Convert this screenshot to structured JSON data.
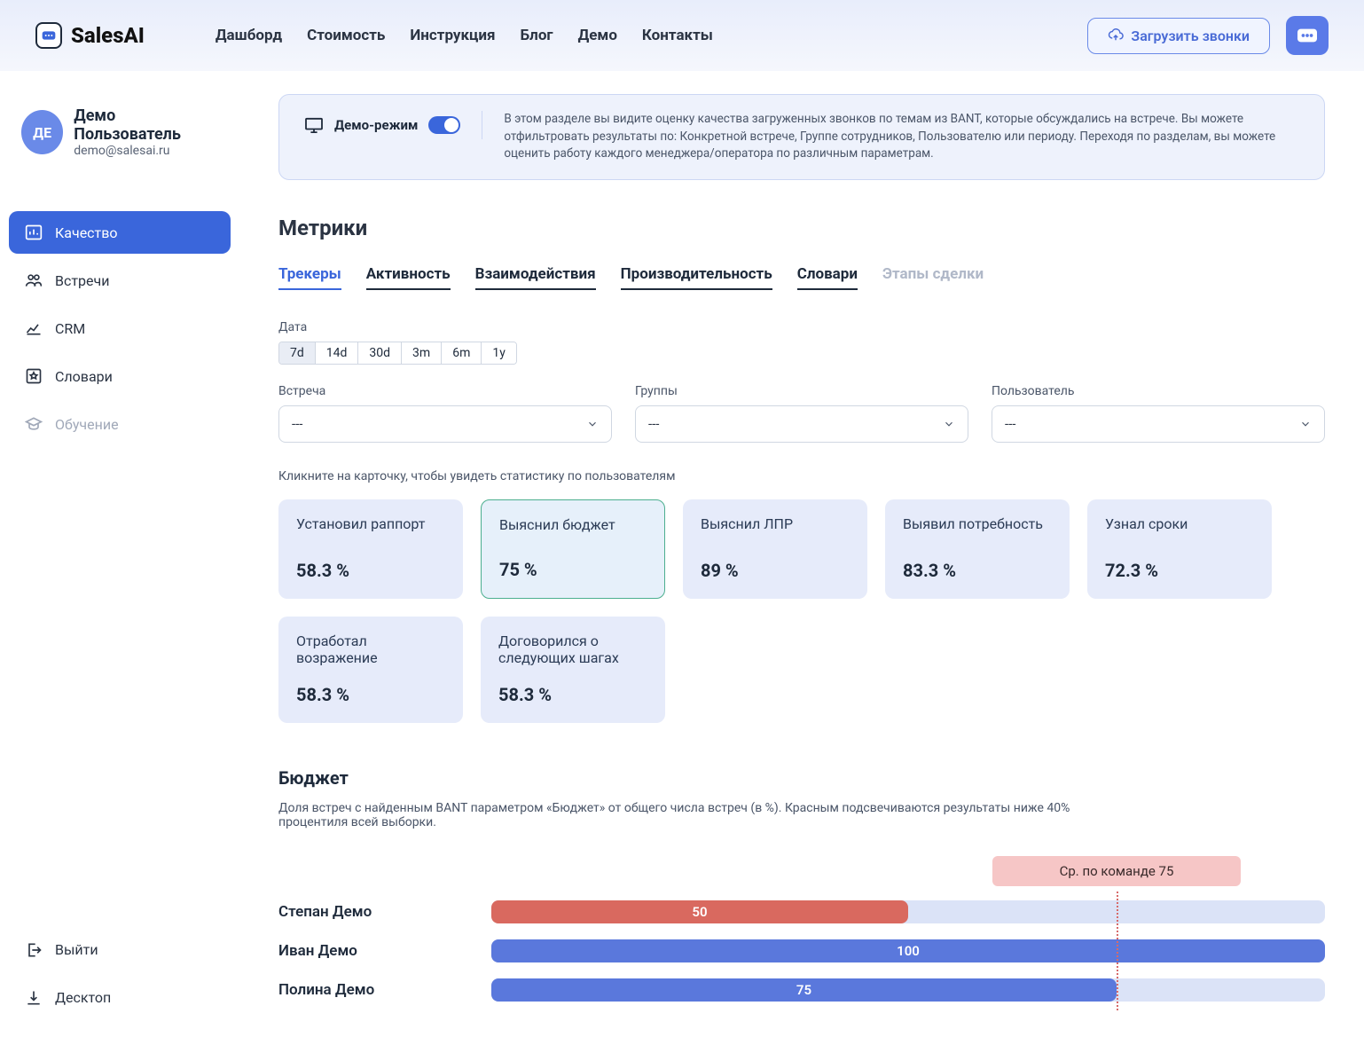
{
  "brand": "SalesAI",
  "nav": [
    "Дашборд",
    "Стоимость",
    "Инструкция",
    "Блог",
    "Демо",
    "Контакты"
  ],
  "header": {
    "upload": "Загрузить звонки"
  },
  "user": {
    "initials": "ДЕ",
    "name": "Демо Пользователь",
    "email": "demo@salesai.ru"
  },
  "sidebar": {
    "items": [
      {
        "label": "Качество",
        "active": true
      },
      {
        "label": "Встречи"
      },
      {
        "label": "CRM"
      },
      {
        "label": "Словари"
      },
      {
        "label": "Обучение",
        "disabled": true
      }
    ],
    "footer": [
      {
        "label": "Выйти"
      },
      {
        "label": "Десктоп"
      }
    ]
  },
  "banner": {
    "mode_label": "Демо-режим",
    "text": "В этом разделе вы видите оценку качества загруженных звонков по темам из BANT, которые обсуждались на встрече. Вы можете отфильтровать результаты по: Конкретной встрече, Группе сотрудников, Пользователю или периоду. Переходя по разделам, вы можете оценить работу каждого менеджера/оператора по различным параметрам."
  },
  "page_title": "Метрики",
  "tabs": [
    {
      "label": "Трекеры",
      "state": "active"
    },
    {
      "label": "Активность"
    },
    {
      "label": "Взаимодействия"
    },
    {
      "label": "Производительность"
    },
    {
      "label": "Словари"
    },
    {
      "label": "Этапы сделки",
      "state": "disabled"
    }
  ],
  "filters": {
    "date_label": "Дата",
    "date_options": [
      "7d",
      "14d",
      "30d",
      "3m",
      "6m",
      "1y"
    ],
    "date_selected": "7d",
    "meeting_label": "Встреча",
    "meeting_value": "---",
    "groups_label": "Группы",
    "groups_value": "---",
    "user_label": "Пользователь",
    "user_value": "---"
  },
  "cards_hint": "Кликните на карточку, чтобы увидеть статистику по пользователям",
  "cards": [
    {
      "title": "Установил раппорт",
      "value": "58.3 %"
    },
    {
      "title": "Выяснил бюджет",
      "value": "75 %",
      "selected": true
    },
    {
      "title": "Выяснил ЛПР",
      "value": "89 %"
    },
    {
      "title": "Выявил потребность",
      "value": "83.3 %"
    },
    {
      "title": "Узнал сроки",
      "value": "72.3 %"
    },
    {
      "title": "Отработал возражение",
      "value": "58.3 %"
    },
    {
      "title": "Договорился о следующих шагах",
      "value": "58.3 %"
    }
  ],
  "section": {
    "title": "Бюджет",
    "desc": "Доля встреч с найденным BANT параметром «Бюджет» от общего числа встреч (в %). Красным подсвечиваются результаты ниже 40% процентиля всей выборки.",
    "avg_label": "Ср. по команде 75"
  },
  "chart_data": {
    "type": "bar",
    "orientation": "horizontal",
    "xlabel": "",
    "ylabel": "",
    "xlim": [
      0,
      100
    ],
    "average": 75,
    "series": [
      {
        "name": "Степан Демо",
        "value": 50,
        "color": "red"
      },
      {
        "name": "Иван Демо",
        "value": 100,
        "color": "blue"
      },
      {
        "name": "Полина Демо",
        "value": 75,
        "color": "blue"
      }
    ]
  }
}
